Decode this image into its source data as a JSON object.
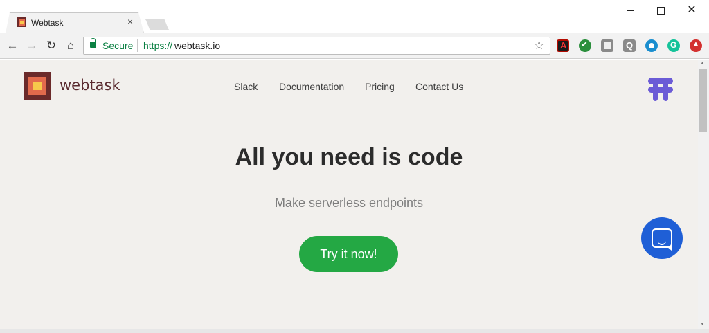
{
  "browser": {
    "tab_title": "Webtask",
    "tab_close": "×",
    "secure_label": "Secure",
    "url_scheme": "https://",
    "url_host": "webtask.io",
    "window_close": "✕"
  },
  "page": {
    "logo_text": "webtask",
    "nav": {
      "slack": "Slack",
      "documentation": "Documentation",
      "pricing": "Pricing",
      "contact": "Contact Us"
    },
    "hero_title": "All you need is code",
    "hero_subtitle": "Make serverless endpoints",
    "cta_label": "Try it now!"
  },
  "colors": {
    "page_background": "#f2f0ed",
    "cta_green": "#24a844",
    "chat_blue": "#1f5fd6",
    "brand_icon_purple": "#6b5bd6",
    "logo_dark": "#6b2a2a",
    "logo_orange": "#e26a4c",
    "logo_yellow": "#f7c94b"
  },
  "icons": {
    "back": "arrow-left-icon",
    "forward": "arrow-right-icon",
    "reload": "reload-icon",
    "home": "home-icon",
    "secure": "lock-icon",
    "bookmark": "star-icon",
    "chat": "chat-icon",
    "brand": "webtask-brand-icon"
  }
}
